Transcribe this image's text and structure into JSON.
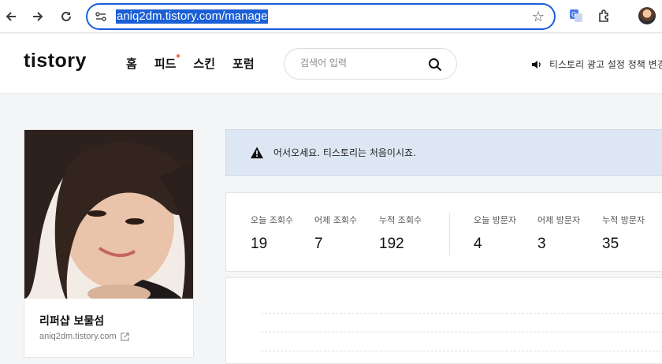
{
  "browser": {
    "url": "aniq2dm.tistory.com/manage",
    "back_icon": "arrow-left-icon",
    "forward_icon": "arrow-right-icon",
    "reload_icon": "reload-icon",
    "site_info_icon": "tune-icon",
    "bookmark_icon": "star-icon",
    "extensions": [
      "translate-icon",
      "puzzle-icon",
      "profile-avatar"
    ]
  },
  "header": {
    "logo": "tistory",
    "nav": [
      {
        "label": "홈"
      },
      {
        "label": "피드",
        "new_dot": true
      },
      {
        "label": "스킨"
      },
      {
        "label": "포럼"
      }
    ],
    "search_placeholder": "검색어 입력",
    "notice": "티스토리 광고 설정 정책 변경"
  },
  "profile": {
    "blog_name": "리퍼샵 보물섬",
    "blog_url": "aniq2dm.tistory.com"
  },
  "welcome": {
    "message": "어서오세요. 티스토리는 처음이시죠."
  },
  "stats": {
    "views": [
      {
        "label": "오늘 조회수",
        "value": "19"
      },
      {
        "label": "어제 조회수",
        "value": "7"
      },
      {
        "label": "누적 조회수",
        "value": "192"
      }
    ],
    "visitors": [
      {
        "label": "오늘 방문자",
        "value": "4"
      },
      {
        "label": "어제 방문자",
        "value": "3"
      },
      {
        "label": "누적 방문자",
        "value": "35"
      }
    ]
  },
  "colors": {
    "accent": "#1a5fd6",
    "banner_bg": "#dde7f4",
    "new_dot": "#ff5544"
  }
}
